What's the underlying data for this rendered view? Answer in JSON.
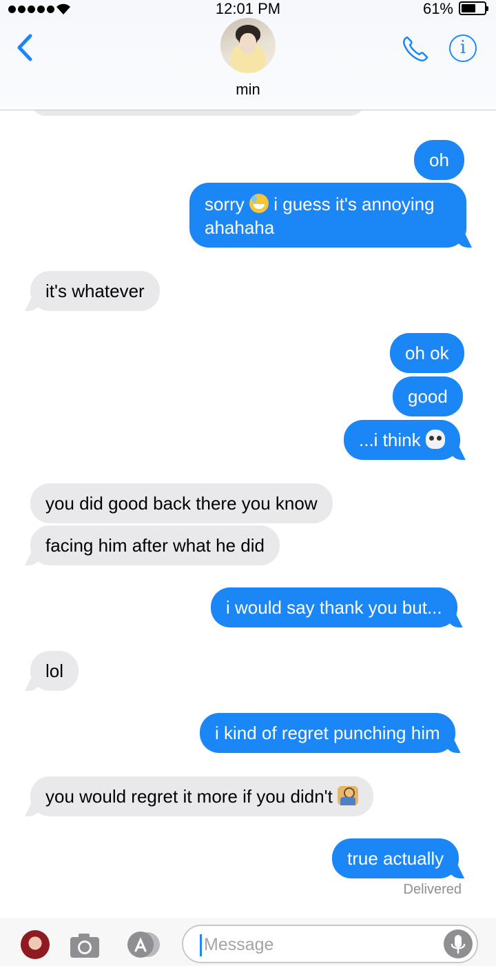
{
  "status_bar": {
    "time": "12:01 PM",
    "battery_percent_label": "61%",
    "battery_level": 0.61,
    "signal_bars": 5
  },
  "header": {
    "contact_name": "min",
    "back_icon": "chevron-left-icon",
    "call_icon": "phone-icon",
    "info_icon": "info-icon",
    "accent_color": "#1b86f6"
  },
  "messages": [
    {
      "from": "me",
      "text": "oh"
    },
    {
      "from": "me",
      "text_before": "sorry",
      "emoji": "sweat-smile-emoji",
      "text_after": "i guess it's annoying",
      "text_line2": "ahahaha"
    },
    {
      "from": "them",
      "text": "it's whatever"
    },
    {
      "from": "me",
      "text": "oh ok"
    },
    {
      "from": "me",
      "text": "good"
    },
    {
      "from": "me",
      "text": "...i think",
      "emoji": "skull-emoji"
    },
    {
      "from": "them",
      "text": "you did good back there you know"
    },
    {
      "from": "them",
      "text": "facing him after what he did"
    },
    {
      "from": "me",
      "text": "i would say thank you but..."
    },
    {
      "from": "them",
      "text": "lol"
    },
    {
      "from": "me",
      "text": "i kind of regret punching him"
    },
    {
      "from": "them",
      "text": "you would regret it more if you didn't",
      "emoji": "man-shrugging-emoji"
    },
    {
      "from": "me",
      "text": "true actually"
    }
  ],
  "delivered_label": "Delivered",
  "input_bar": {
    "placeholder": "Message",
    "value": "",
    "camera_icon": "camera-icon",
    "apps_icon": "app-store-icon",
    "mic_icon": "microphone-icon"
  },
  "colors": {
    "sent_bubble": "#1b86f6",
    "received_bubble": "#e9e9eb",
    "delivered_text": "#8e8e93"
  }
}
